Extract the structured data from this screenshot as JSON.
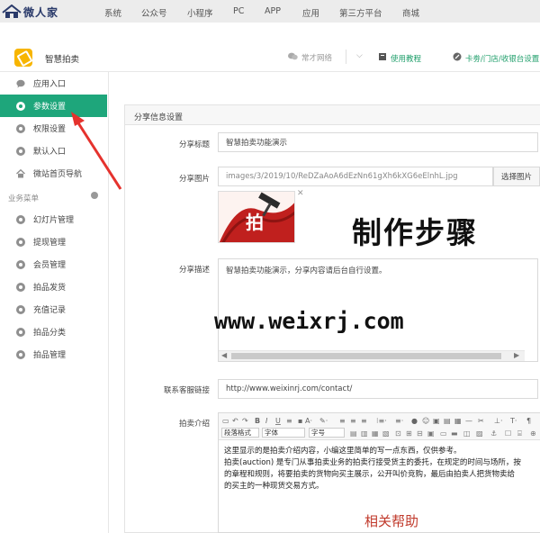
{
  "brand": {
    "name": "微人家"
  },
  "topnav": [
    "系统",
    "公众号",
    "小程序",
    "PC",
    "APP",
    "应用",
    "第三方平台",
    "商城"
  ],
  "subbar": {
    "app_title": "智慧拍卖",
    "actions": [
      {
        "label": "常才网络",
        "icon": "wechat-icon",
        "color": "#9a9a9a"
      },
      {
        "label": "使用教程",
        "icon": "book-icon",
        "color": "#1e9e6a"
      },
      {
        "label": "卡劵/门店/收银台设置",
        "icon": "pencil-icon",
        "color": "#1e9e6a"
      }
    ]
  },
  "sidebar": {
    "items": [
      {
        "label": "应用入口",
        "icon": "chat-icon"
      },
      {
        "label": "参数设置",
        "icon": "gear-icon",
        "active": true
      },
      {
        "label": "权限设置",
        "icon": "gear-icon"
      },
      {
        "label": "默认入口",
        "icon": "gear-icon"
      },
      {
        "label": "微站首页导航",
        "icon": "home-icon"
      }
    ],
    "section_title": "业务菜单",
    "business_items": [
      {
        "label": "幻灯片管理"
      },
      {
        "label": "提现管理"
      },
      {
        "label": "会员管理"
      },
      {
        "label": "拍品发货"
      },
      {
        "label": "充值记录"
      },
      {
        "label": "拍品分类"
      },
      {
        "label": "拍品管理"
      }
    ]
  },
  "panel": {
    "title": "分享信息设置",
    "share_title_label": "分享标题",
    "share_title_value": "智慧拍卖功能演示",
    "share_image_label": "分享图片",
    "share_image_value": "images/3/2019/10/ReDZaAoA6dEzNn61gXh6kXG6eElnhL.jpg",
    "choose_image_button": "选择图片",
    "share_desc_label": "分享描述",
    "share_desc_value": "智慧拍卖功能演示，分享内容请后台自行设置。",
    "service_label": "联系客服链接",
    "service_value": "http://www.weixinrj.com/contact/",
    "intro_label": "拍卖介绍",
    "editor_toolbar": {
      "paragraph_select": "段落格式",
      "font_select": "字体",
      "size_select": "字号"
    },
    "editor_content": [
      "这里显示的是拍卖介绍内容，小编这里简单的写一点东西，仅供参考。",
      "拍卖(auction) 是专门从事拍卖业务的拍卖行接受货主的委托，在规定的时间与场所，按",
      "的章程和规则，将要拍卖的货物向买主展示，公开叫价竞购，最后由拍卖人把货物卖给",
      "的买主的一种现货交易方式。"
    ],
    "thumbnail_text": "拍"
  },
  "overlay": {
    "title": "制作步骤",
    "url": "www.weixrj.com",
    "help": "相关帮助"
  },
  "colors": {
    "accent": "#1ea67b",
    "arrow": "#e5322d",
    "topbar": "#ececec"
  }
}
